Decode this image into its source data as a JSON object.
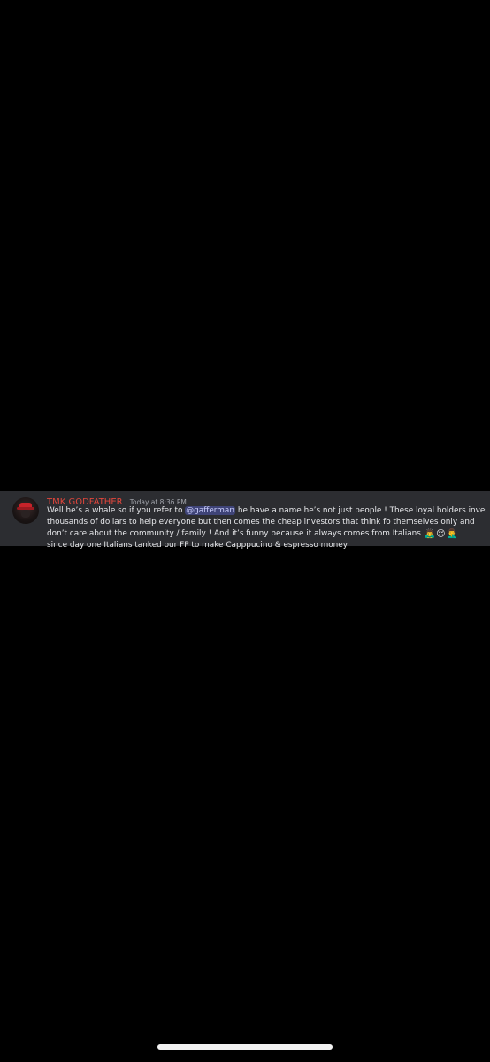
{
  "message": {
    "username": "TMK GODFATHER",
    "timestamp": "Today at 8:36 PM",
    "line1_before": "Well he’s a whale so if you refer to ",
    "mention": "@gafferman",
    "line1_after": " he have a name he’s not just people ! These loyal holders invest",
    "line2": "thousands of dollars to help everyone but then comes the cheap investors that think fo themselves only and",
    "line3": "don’t care about the community / family ! And it’s funny because it always comes from Italians ",
    "line4": "since day one Italians tanked our FP to make Capppucino & espresso money",
    "emojis": [
      "🙇‍♂️",
      "😌",
      "🤦‍♂️"
    ]
  },
  "colors": {
    "background": "#000000",
    "message_bg": "#2c2d31",
    "username": "#e0463c",
    "mention_bg": "#3f4478",
    "mention_text": "#c9cdfb"
  },
  "icons": {
    "avatar": "mafia-hat-avatar",
    "home_indicator": "home-indicator-bar"
  }
}
